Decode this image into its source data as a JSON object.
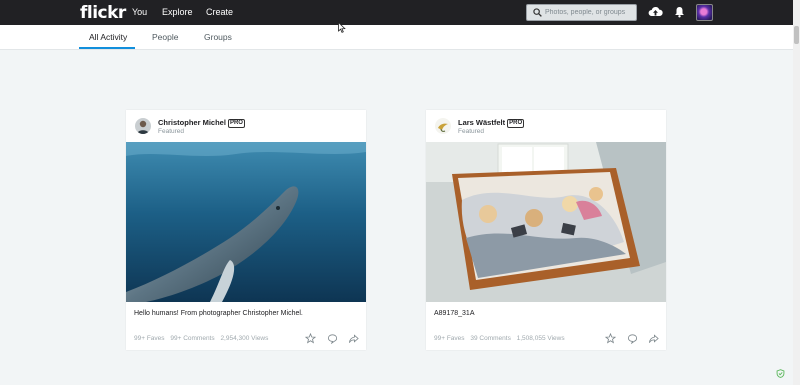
{
  "header": {
    "logo": "flickr",
    "nav": [
      "You",
      "Explore",
      "Create"
    ],
    "search_placeholder": "Photos, people, or groups"
  },
  "tabs": [
    {
      "label": "All Activity",
      "active": true
    },
    {
      "label": "People",
      "active": false
    },
    {
      "label": "Groups",
      "active": false
    }
  ],
  "cards": [
    {
      "author": "Christopher Michel",
      "badge": "PRO",
      "subtitle": "Featured",
      "photo": "humpback-whale-underwater",
      "caption": "Hello humans! From photographer Christopher Michel.",
      "faves": "99+ Faves",
      "comments": "99+ Comments",
      "views": "2,954,300 Views"
    },
    {
      "author": "Lars Wästfelt",
      "badge": "PRO",
      "subtitle": "Featured",
      "photo": "family-in-wooden-bed",
      "caption": "A89178_31A",
      "faves": "99+ Faves",
      "comments": "39 Comments",
      "views": "1,508,055 Views"
    }
  ],
  "colors": {
    "topbar": "#212124",
    "accent": "#128fdc",
    "background": "#f2f5f6"
  }
}
